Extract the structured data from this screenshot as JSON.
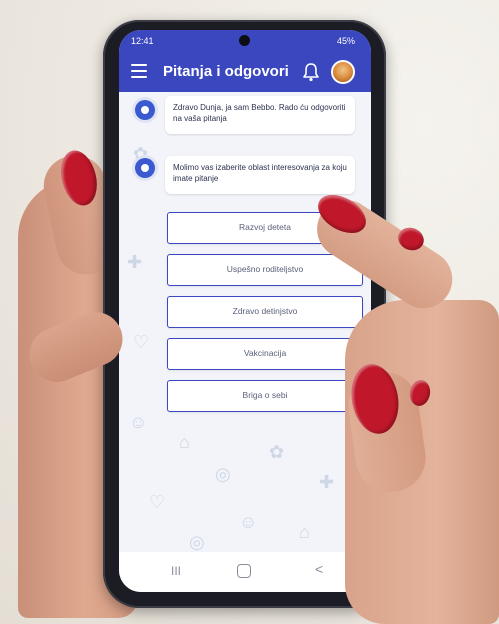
{
  "status_bar": {
    "time": "12:41",
    "indicators_right": "45%"
  },
  "app_bar": {
    "title": "Pitanja i odgovori"
  },
  "chat": {
    "messages": [
      {
        "text": "Zdravo Dunja, ja sam Bebbo. Rado ću odgovoriti na vaša pitanja"
      },
      {
        "text": "Molimo vas izaberite oblast interesovanja za koju imate pitanje"
      }
    ],
    "options": [
      {
        "label": "Razvoj deteta"
      },
      {
        "label": "Uspešno roditeljstvo"
      },
      {
        "label": "Zdravo detinjstvo"
      },
      {
        "label": "Vakcinacija"
      },
      {
        "label": "Briga o sebi"
      }
    ]
  },
  "nav_bar": {
    "recent_glyph": "III",
    "back_glyph": "<"
  },
  "colors": {
    "brand": "#3b47bf",
    "bot_avatar": "#3b5ad0",
    "nail_polish": "#c0182a",
    "background": "#efebe4"
  },
  "icons": [
    "menu-icon",
    "bell-icon",
    "avatar",
    "bot-avatar-icon"
  ]
}
